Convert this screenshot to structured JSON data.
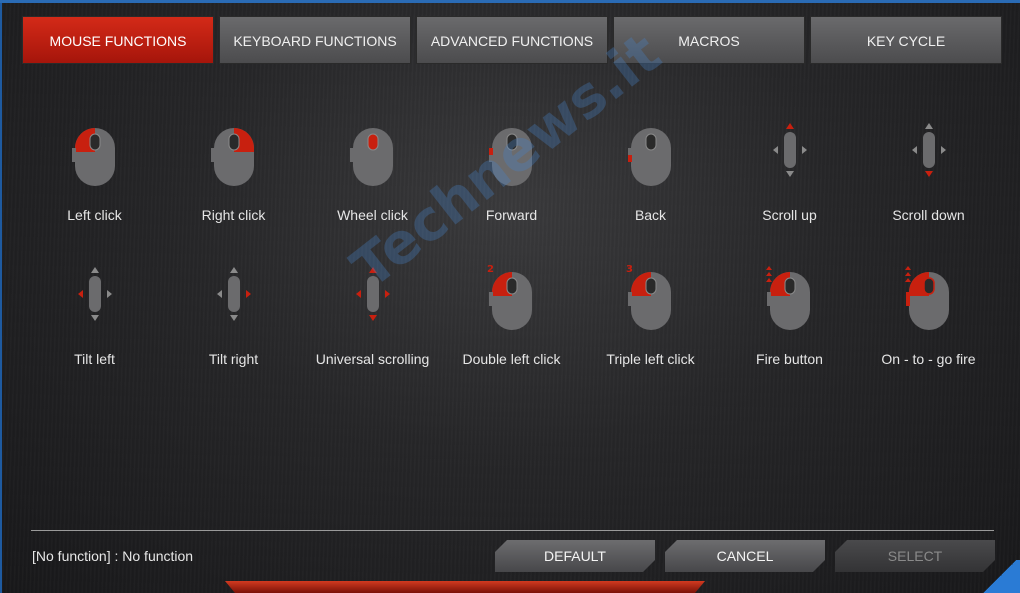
{
  "tabs": [
    {
      "label": "MOUSE FUNCTIONS",
      "active": true
    },
    {
      "label": "KEYBOARD FUNCTIONS",
      "active": false
    },
    {
      "label": "ADVANCED FUNCTIONS",
      "active": false
    },
    {
      "label": "MACROS",
      "active": false
    },
    {
      "label": "KEY CYCLE",
      "active": false
    }
  ],
  "functions": [
    {
      "label": "Left click",
      "icon": "mouse-left-click-icon"
    },
    {
      "label": "Right click",
      "icon": "mouse-right-click-icon"
    },
    {
      "label": "Wheel click",
      "icon": "mouse-wheel-click-icon"
    },
    {
      "label": "Forward",
      "icon": "mouse-forward-icon"
    },
    {
      "label": "Back",
      "icon": "mouse-back-icon"
    },
    {
      "label": "Scroll up",
      "icon": "scroll-up-icon"
    },
    {
      "label": "Scroll down",
      "icon": "scroll-down-icon"
    },
    {
      "label": "Tilt left",
      "icon": "tilt-left-icon"
    },
    {
      "label": "Tilt right",
      "icon": "tilt-right-icon"
    },
    {
      "label": "Universal scrolling",
      "icon": "universal-scrolling-icon"
    },
    {
      "label": "Double left click",
      "icon": "double-left-click-icon",
      "badge": "2"
    },
    {
      "label": "Triple left click",
      "icon": "triple-left-click-icon",
      "badge": "3"
    },
    {
      "label": "Fire button",
      "icon": "fire-button-icon"
    },
    {
      "label": "On - to - go fire",
      "icon": "on-to-go-fire-icon"
    }
  ],
  "status": "[No function] : No function",
  "buttons": {
    "default": "DEFAULT",
    "cancel": "CANCEL",
    "select": "SELECT"
  },
  "watermark": "Technews.it",
  "colors": {
    "accent": "#c8200f",
    "icon_gray": "#6b6b6d",
    "text": "#e6e6e6"
  }
}
